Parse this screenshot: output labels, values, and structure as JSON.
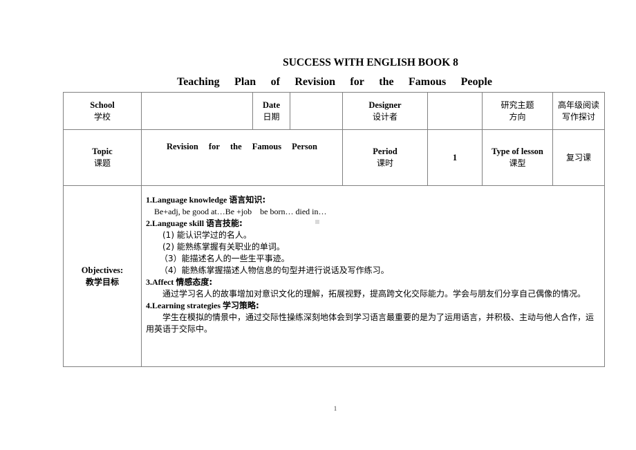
{
  "header": {
    "book_title": "SUCCESS WITH ENGLISH BOOK 8",
    "plan_title_words": [
      "Teaching",
      "Plan",
      "of",
      "Revision",
      "for",
      "the",
      "Famous",
      "People"
    ]
  },
  "table": {
    "row1": {
      "school_label_en": "School",
      "school_label_zh": "学校",
      "school_value": "",
      "date_label_en": "Date",
      "date_label_zh": "日期",
      "date_value": "",
      "designer_label_en": "Designer",
      "designer_label_zh": "设计者",
      "designer_value": "",
      "research_label_line1": "研究主题",
      "research_label_line2": "方向",
      "research_value": "高年级阅读写作探讨"
    },
    "row2": {
      "topic_label_en": "Topic",
      "topic_label_zh": "课题",
      "topic_value_words": [
        "Revision",
        "for",
        "the",
        "Famous",
        "Person"
      ],
      "period_label_en": "Period",
      "period_label_zh": "课时",
      "period_value": "1",
      "lesson_type_label_en": "Type of lesson",
      "lesson_type_label_zh": "课型",
      "lesson_type_value": "复习课"
    },
    "row3": {
      "objectives_label_en": "Objectives:",
      "objectives_label_zh": "教学目标",
      "sections": {
        "knowledge_heading_en": "1.Language knowledge ",
        "knowledge_heading_zh": "语言知识:",
        "knowledge_text": "Be+adj, be good at…Be +job    be born… died in…",
        "skill_heading_en": "2.Language skill ",
        "skill_heading_zh": "语言技能:",
        "skill_items": [
          "(1)  能认识学过的名人。",
          "(2)  能熟练掌握有关职业的单词。",
          "（3）能描述名人的一些生平事迹。",
          "（4）能熟练掌握描述人物信息的句型并进行说话及写作练习。"
        ],
        "affect_heading_en": "3.Affect  ",
        "affect_heading_zh": "情感态度:",
        "affect_text": "通过学习名人的故事增加对意识文化的理解，拓展视野，提高跨文化交际能力。学会与朋友们分享自己偶像的情况。",
        "strategy_heading_en": "4.Learning strategies ",
        "strategy_heading_zh": "学习策略:",
        "strategy_text": "学生在模拟的情景中，通过交际性操练深刻地体会到学习语言最重要的是为了运用语言，并积极、主动与他人合作，运用英语于交际中。"
      }
    }
  },
  "footer": {
    "page_number": "1"
  }
}
